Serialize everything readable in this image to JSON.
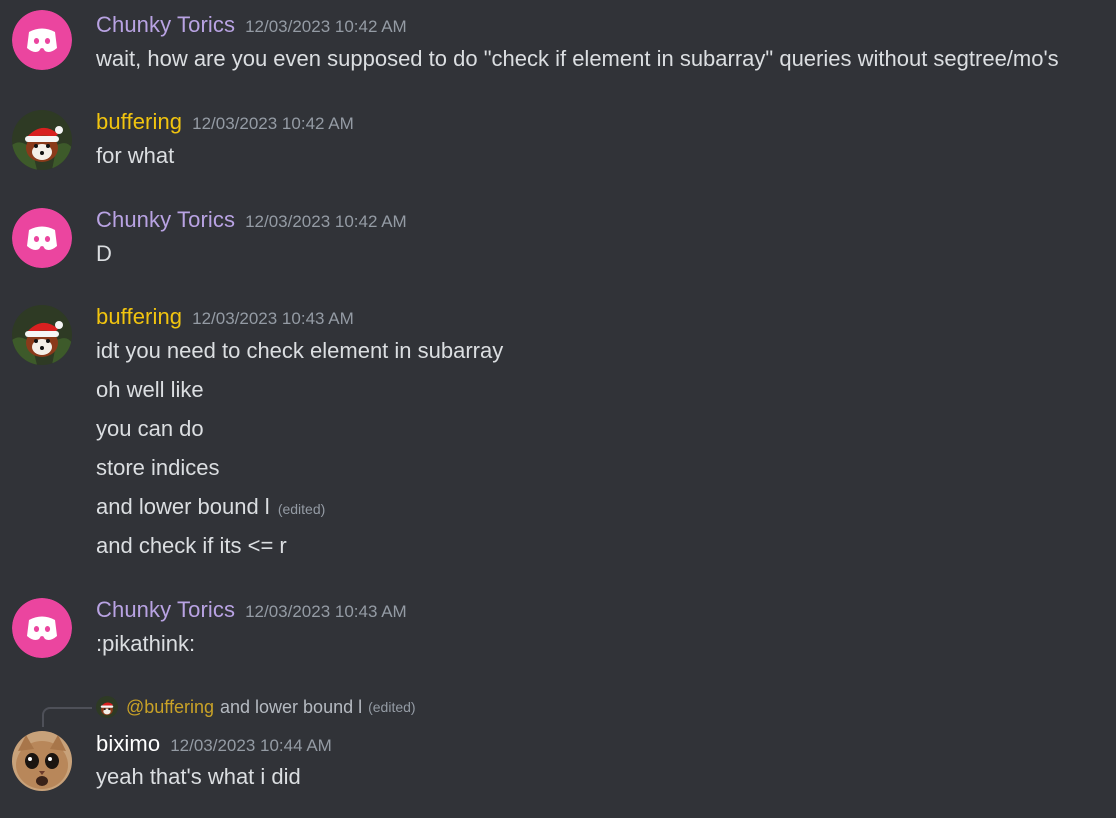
{
  "colors": {
    "background": "#313338",
    "chunky_name": "#b9a3e3",
    "buffering_name": "#f1c40f",
    "biximo_name": "#ffffff",
    "discord_pink": "#eb459f",
    "timestamp": "#949ba4",
    "text": "#dbdee1"
  },
  "messages": [
    {
      "author": "Chunky Torics",
      "avatar_icon": "discord-logo-icon",
      "timestamp": "12/03/2023 10:42 AM",
      "lines": [
        "wait, how are you even supposed to do \"check if element in subarray\" queries without segtree/mo's"
      ]
    },
    {
      "author": "buffering",
      "avatar_icon": "red-panda-santa-hat-avatar",
      "timestamp": "12/03/2023 10:42 AM",
      "lines": [
        "for what"
      ]
    },
    {
      "author": "Chunky Torics",
      "avatar_icon": "discord-logo-icon",
      "timestamp": "12/03/2023 10:42 AM",
      "lines": [
        "D"
      ]
    },
    {
      "author": "buffering",
      "avatar_icon": "red-panda-santa-hat-avatar",
      "timestamp": "12/03/2023 10:43 AM",
      "lines": [
        "idt you need to check element in subarray",
        "oh well like",
        "you can do",
        "store indices",
        "and lower bound l",
        "and check if its <= r"
      ],
      "edited_label": "(edited)"
    },
    {
      "author": "Chunky Torics",
      "avatar_icon": "discord-logo-icon",
      "timestamp": "12/03/2023 10:43 AM",
      "lines": [
        ":pikathink:"
      ]
    },
    {
      "author": "biximo",
      "avatar_icon": "cat-avatar",
      "timestamp": "12/03/2023 10:44 AM",
      "lines": [
        "yeah that's what i did"
      ],
      "reply": {
        "mention": "@buffering",
        "text": "and lower bound l",
        "edited_label": "(edited)"
      }
    }
  ]
}
